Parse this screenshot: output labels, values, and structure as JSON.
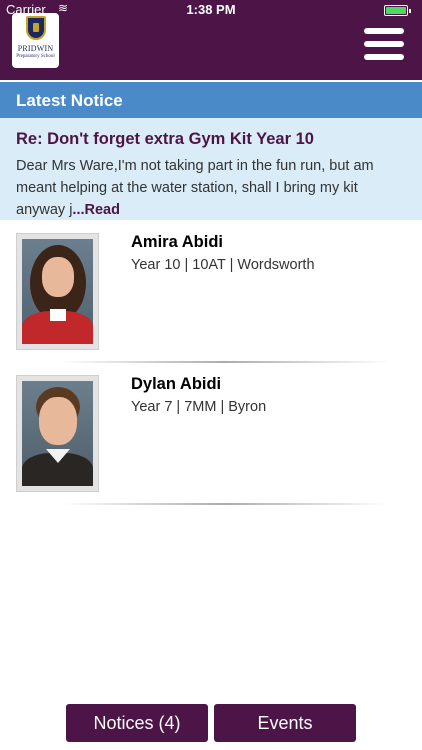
{
  "status_bar": {
    "carrier": "Carrier",
    "wifi_icon": "wifi-icon",
    "time": "1:38 PM",
    "battery_level": 1.0,
    "battery_color": "#4cd964"
  },
  "header": {
    "logo": {
      "name": "PRIDWIN",
      "subtitle": "Preparatory School"
    },
    "menu_icon": "hamburger-menu-icon",
    "background_color": "#4d1547"
  },
  "latest_notice": {
    "heading": "Latest Notice",
    "title": "Re: Don't forget extra Gym Kit Year 10",
    "body": "Dear Mrs Ware,I'm not taking part in the fun run, but am meant helping at the water station, shall I bring my kit anyway j",
    "read_more": "...Read",
    "heading_color": "#4a8ac9",
    "card_color": "#d9ecf8"
  },
  "students": [
    {
      "name": "Amira Abidi",
      "info": "Year 10 | 10AT | Wordsworth"
    },
    {
      "name": "Dylan Abidi",
      "info": "Year 7 | 7MM | Byron"
    }
  ],
  "footer": {
    "notices_label": "Notices (4)",
    "events_label": "Events"
  }
}
